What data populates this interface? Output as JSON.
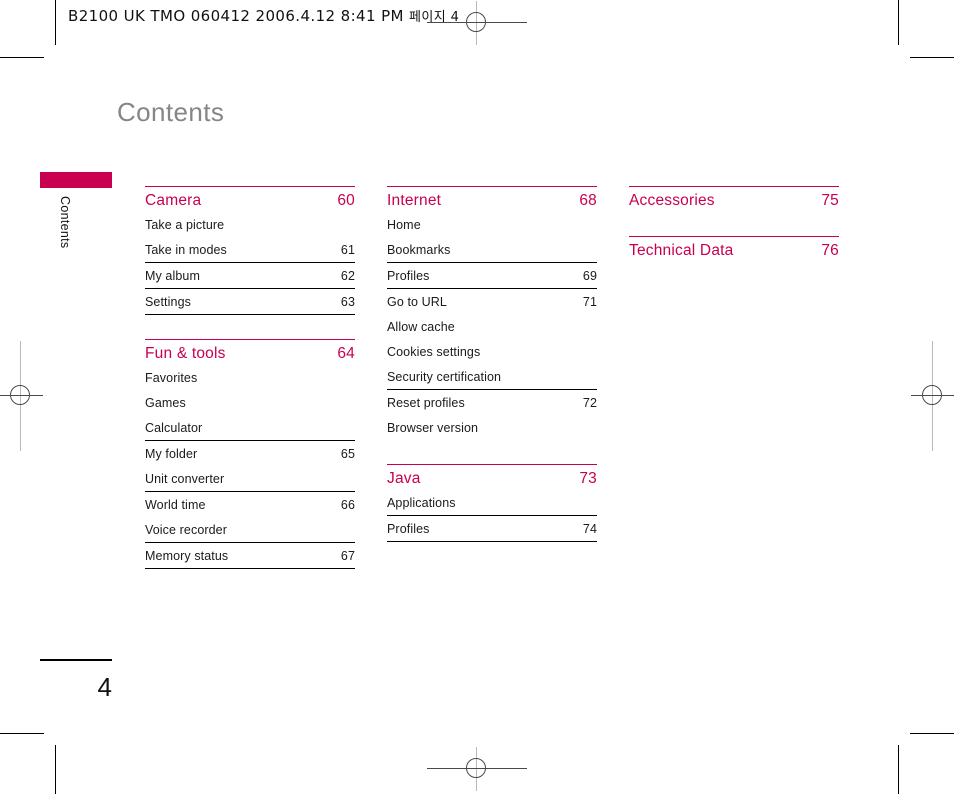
{
  "slug": {
    "text": "B2100 UK TMO 060412  2006.4.12 8:41 PM",
    "korean": "페이지 4"
  },
  "page_heading": "Contents",
  "side_tab": {
    "label": "Contents",
    "color": "#c8004f"
  },
  "folio": {
    "number": "4"
  },
  "accent_color": "#c8004f",
  "heading_color": "#868686",
  "toc": {
    "columns": [
      {
        "sections": [
          {
            "title": "Camera",
            "page": "60",
            "entries": [
              {
                "label": "Take a picture",
                "page": "",
                "ruled": false
              },
              {
                "label": "Take in modes",
                "page": "61",
                "ruled": true
              },
              {
                "label": "My album",
                "page": "62",
                "ruled": true
              },
              {
                "label": "Settings",
                "page": "63",
                "ruled": true
              }
            ]
          },
          {
            "title": "Fun & tools",
            "page": "64",
            "entries": [
              {
                "label": "Favorites",
                "page": "",
                "ruled": false
              },
              {
                "label": "Games",
                "page": "",
                "ruled": false
              },
              {
                "label": "Calculator",
                "page": "",
                "ruled": true
              },
              {
                "label": "My folder",
                "page": "65",
                "ruled": false
              },
              {
                "label": "Unit converter",
                "page": "",
                "ruled": true
              },
              {
                "label": "World time",
                "page": "66",
                "ruled": false
              },
              {
                "label": "Voice recorder",
                "page": "",
                "ruled": true
              },
              {
                "label": "Memory status",
                "page": "67",
                "ruled": true
              }
            ]
          }
        ]
      },
      {
        "sections": [
          {
            "title": "Internet",
            "page": "68",
            "entries": [
              {
                "label": "Home",
                "page": "",
                "ruled": false
              },
              {
                "label": "Bookmarks",
                "page": "",
                "ruled": true
              },
              {
                "label": "Profiles",
                "page": "69",
                "ruled": true
              },
              {
                "label": "Go to URL",
                "page": "71",
                "ruled": false
              },
              {
                "label": "Allow cache",
                "page": "",
                "ruled": false
              },
              {
                "label": "Cookies settings",
                "page": "",
                "ruled": false
              },
              {
                "label": "Security certification",
                "page": "",
                "ruled": true
              },
              {
                "label": "Reset profiles",
                "page": "72",
                "ruled": false
              },
              {
                "label": "Browser version",
                "page": "",
                "ruled": false
              }
            ]
          },
          {
            "title": "Java",
            "page": "73",
            "entries": [
              {
                "label": "Applications",
                "page": "",
                "ruled": true
              },
              {
                "label": "Profiles",
                "page": "74",
                "ruled": true
              }
            ]
          }
        ]
      },
      {
        "sections": [
          {
            "title": "Accessories",
            "page": "75",
            "entries": []
          },
          {
            "title": "Technical Data",
            "page": "76",
            "entries": []
          }
        ]
      }
    ]
  }
}
